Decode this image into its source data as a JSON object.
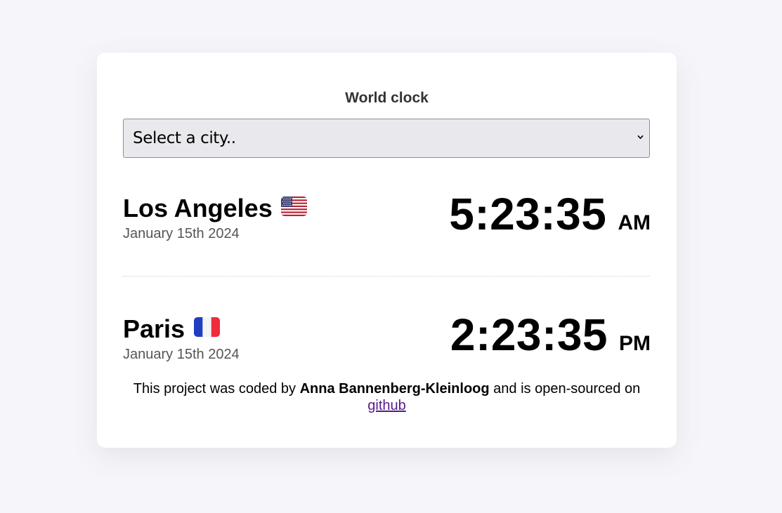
{
  "app": {
    "title": "World clock"
  },
  "select": {
    "selected": "Select a city.."
  },
  "cities": [
    {
      "name": "Los Angeles",
      "flag": "us-flag-icon",
      "date": "January 15th 2024",
      "time": "5:23:35",
      "ampm": "AM"
    },
    {
      "name": "Paris",
      "flag": "fr-flag-icon",
      "date": "January 15th 2024",
      "time": "2:23:35",
      "ampm": "PM"
    }
  ],
  "footer": {
    "prefix": "This project was coded by",
    "author": "Anna Bannenberg-Kleinloog",
    "middle": "and is open-sourced on",
    "link_label": "github"
  },
  "colors": {
    "background": "#f6f6fa",
    "card": "#ffffff",
    "link": "#551a8b",
    "date_text": "#555555"
  }
}
